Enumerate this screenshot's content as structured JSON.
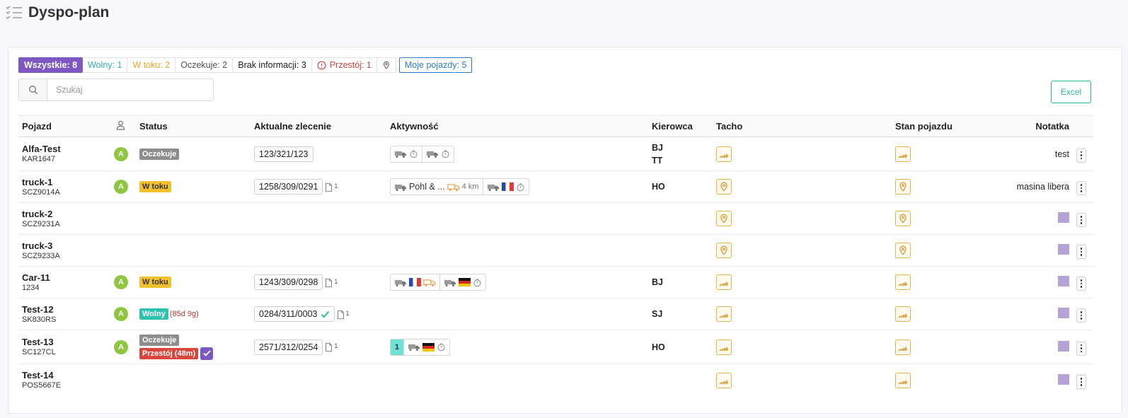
{
  "page": {
    "title": "Dyspo-plan"
  },
  "filters": {
    "all": "Wszystkie: 8",
    "free": "Wolny: 1",
    "in_progress": "W toku: 2",
    "waiting": "Oczekuje: 2",
    "no_info": "Brak informacji: 3",
    "idle": "Przestój: 1",
    "my_vehicles": "Moje pojazdy: 5"
  },
  "search": {
    "placeholder": "Szukaj"
  },
  "toolbar": {
    "excel_label": "Excel"
  },
  "table": {
    "headers": {
      "vehicle": "Pojazd",
      "status": "Status",
      "order": "Aktualne zlecenie",
      "activity": "Aktywność",
      "driver": "Kierowca",
      "tacho": "Tacho",
      "state": "Stan pojazdu",
      "note": "Notatka"
    },
    "rows": [
      {
        "name": "Alfa-Test",
        "plate": "KAR1647",
        "avatar": "A",
        "status": "Oczekuje",
        "order": "123/321/123",
        "drivers": [
          "BJ",
          "TT"
        ],
        "note": "test"
      },
      {
        "name": "truck-1",
        "plate": "SCZ9014A",
        "avatar": "A",
        "status": "W toku",
        "order": "1258/309/0291",
        "doc_count": "1",
        "activity_company": "Pohl & ...",
        "activity_distance": "4 km",
        "drivers": [
          "HO"
        ],
        "note": "masina libera"
      },
      {
        "name": "truck-2",
        "plate": "SCZ9231A"
      },
      {
        "name": "truck-3",
        "plate": "SCZ9233A"
      },
      {
        "name": "Car-11",
        "plate": "1234",
        "avatar": "A",
        "status": "W toku",
        "order": "1243/309/0298",
        "doc_count": "1",
        "drivers": [
          "BJ"
        ]
      },
      {
        "name": "Test-12",
        "plate": "SK830RS",
        "avatar": "A",
        "status": "Wolny",
        "status_duration": "(85d 9g)",
        "order": "0284/311/0003",
        "doc_count": "1",
        "drivers": [
          "SJ"
        ]
      },
      {
        "name": "Test-13",
        "plate": "SC127CL",
        "avatar": "A",
        "status": "Oczekuje",
        "status2": "Przestój (48m)",
        "order": "2571/312/0254",
        "doc_count": "1",
        "activity_count": "1",
        "drivers": [
          "HO"
        ]
      },
      {
        "name": "Test-14",
        "plate": "POS5667E"
      }
    ]
  },
  "icons": {
    "title": "checklist-icon",
    "search": "search-icon",
    "driver_header": "user-icon",
    "tacho": "signal-icon",
    "location": "location-pin-icon",
    "document": "document-icon",
    "truck": "truck-icon",
    "timer": "timer-icon",
    "menu": "kebab-menu-icon"
  },
  "colors": {
    "accent": "#7e57c2",
    "free": "#2dc3b0",
    "in_progress": "#f5a623",
    "idle": "#d9443d",
    "mine": "#2d7fd2",
    "tacho_border": "#e7b546"
  }
}
